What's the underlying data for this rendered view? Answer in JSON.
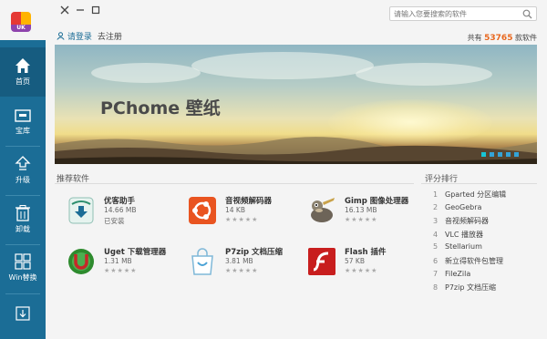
{
  "window": {
    "search_placeholder": "请输入您要搜索的软件"
  },
  "logo": {
    "text": "UK"
  },
  "sidebar": {
    "items": [
      {
        "label": "首页",
        "icon": "home-icon"
      },
      {
        "label": "宝库",
        "icon": "store-icon"
      },
      {
        "label": "升级",
        "icon": "upgrade-icon"
      },
      {
        "label": "卸载",
        "icon": "trash-icon"
      },
      {
        "label": "Win替换",
        "icon": "windows-grid-icon"
      },
      {
        "label": "",
        "icon": "download-icon"
      }
    ]
  },
  "header": {
    "login": "请登录",
    "register": "去注册",
    "total_prefix": "共有",
    "total_count": "53765",
    "total_suffix": "款软件"
  },
  "banner": {
    "title": "PChome 壁纸"
  },
  "recommended": {
    "title": "推荐软件",
    "apps": [
      {
        "name": "优客助手",
        "size": "14.66 MB",
        "status": "已安装",
        "stars": ""
      },
      {
        "name": "音视频解码器",
        "size": "14 KB",
        "status": "",
        "stars": "★★★★★"
      },
      {
        "name": "Gimp 图像处理器",
        "size": "16.13 MB",
        "status": "",
        "stars": "★★★★★"
      },
      {
        "name": "Uget 下载管理器",
        "size": "1.31 MB",
        "status": "",
        "stars": "★★★★★"
      },
      {
        "name": "P7zip 文档压缩",
        "size": "3.81 MB",
        "status": "",
        "stars": "★★★★★"
      },
      {
        "name": "Flash 插件",
        "size": "57 KB",
        "status": "",
        "stars": "★★★★★"
      }
    ]
  },
  "ranking": {
    "title": "评分排行",
    "items": [
      {
        "rank": "1",
        "name": "Gparted 分区编辑"
      },
      {
        "rank": "2",
        "name": "GeoGebra"
      },
      {
        "rank": "3",
        "name": "音视频解码器"
      },
      {
        "rank": "4",
        "name": "VLC 播放器"
      },
      {
        "rank": "5",
        "name": "Stellarium"
      },
      {
        "rank": "6",
        "name": "新立得软件包管理"
      },
      {
        "rank": "7",
        "name": "FileZila"
      },
      {
        "rank": "8",
        "name": "P7zip 文档压缩"
      }
    ]
  },
  "colors": {
    "sidebar": "#1b6d96",
    "accent": "#1b6d96",
    "count": "#e8681f"
  }
}
